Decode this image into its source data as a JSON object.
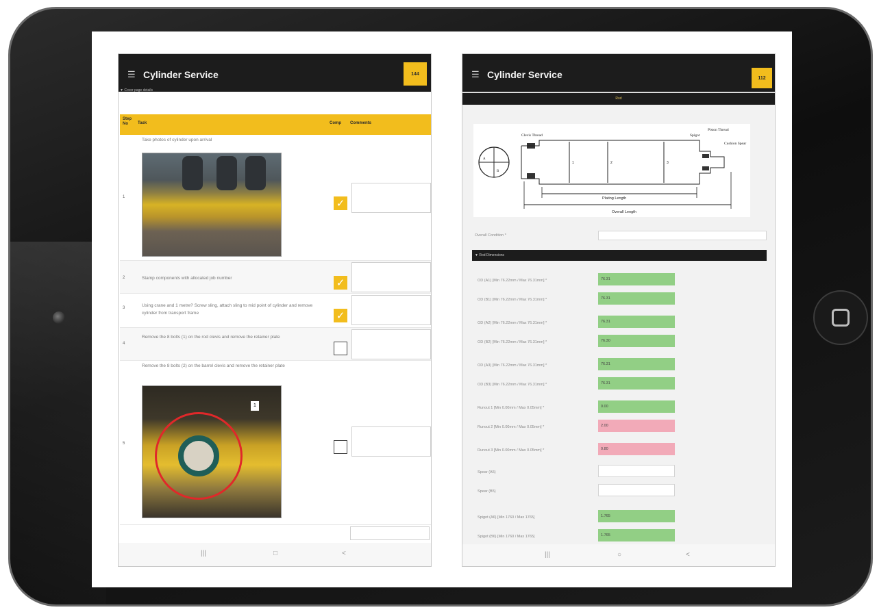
{
  "left_app": {
    "menu_icon": "☰",
    "title": "Cylinder Service",
    "badge": "144",
    "subtitle": "▼ Cover page details",
    "table": {
      "col_step": "Step No",
      "col_task": "Task",
      "col_comp": "Comp",
      "col_comments": "Comments"
    },
    "steps": [
      {
        "num": "1",
        "task": "Take photos of cylinder upon arrival",
        "checked": true
      },
      {
        "num": "2",
        "task": "Stamp components with allocated job number",
        "checked": true
      },
      {
        "num": "3",
        "task": "Using crane and 1 metre? Screw sling, attach sling to mid point of cylinder and remove cylinder from transport frame",
        "checked": true
      },
      {
        "num": "4",
        "task": "Remove the 8 bolts (1) on the rod clevis and remove the retainer plate",
        "checked": false
      },
      {
        "num": "5",
        "task": "Remove the 8 bolts (2) on the barrel clevis and remove the retainer plate",
        "checked": false
      }
    ],
    "photo_tag": "1",
    "checkmark": "✓",
    "nav": {
      "recent": "|||",
      "home": "□",
      "back": "<"
    }
  },
  "right_app": {
    "menu_icon": "☰",
    "title": "Cylinder Service",
    "badge": "112",
    "tab": "Rod",
    "diagram": {
      "clevis_thread": "Clevis Thread",
      "spigot": "Spigot",
      "piston_thread": "Piston Thread",
      "cushion_spear": "Cushion Spear",
      "plating_length": "Plating Length",
      "overall_length": "Overall Length",
      "a": "A",
      "b": "B",
      "m1": "1",
      "m2": "2",
      "m3": "3"
    },
    "overall_condition_label": "Overall Condition *",
    "overall_condition_value": "",
    "section": "▼ Rod Dimensions",
    "fields": [
      {
        "label": "OD (A1) [Min 76.22mm / Max 76.31mm] *",
        "value": "76.31",
        "status": "green"
      },
      {
        "label": "OD (B1) [Min 76.22mm / Max 76.31mm] *",
        "value": "76.31",
        "status": "green"
      },
      {
        "label": "OD (A2) [Min 76.22mm / Max 76.31mm] *",
        "value": "76.31",
        "status": "green"
      },
      {
        "label": "OD (B2) [Min 76.22mm / Max 76.31mm] *",
        "value": "76.30",
        "status": "green"
      },
      {
        "label": "OD (A3) [Min 76.22mm / Max 76.31mm] *",
        "value": "76.31",
        "status": "green"
      },
      {
        "label": "OD (B3) [Min 76.22mm / Max 76.31mm] *",
        "value": "76.31",
        "status": "green"
      },
      {
        "label": "Runout 1 [Min 0.00mm / Max 0.05mm] *",
        "value": "0.00",
        "status": "green"
      },
      {
        "label": "Runout 2 [Min 0.00mm / Max 0.05mm] *",
        "value": "2.00",
        "status": "red"
      },
      {
        "label": "Runout 3 [Min 0.00mm / Max 0.05mm] *",
        "value": "0.80",
        "status": "red"
      },
      {
        "label": "Spear (A5)",
        "value": "",
        "status": "none"
      },
      {
        "label": "Spear (B5)",
        "value": "",
        "status": "none"
      },
      {
        "label": "Spigot (A6) [Min 1760 / Max 1765]",
        "value": "1.765",
        "status": "green"
      },
      {
        "label": "Spigot (B6) [Min 1760 / Max 1765]",
        "value": "1.765",
        "status": "green"
      }
    ],
    "nav": {
      "recent": "|||",
      "home": "○",
      "back": "<"
    }
  },
  "colors": {
    "accent": "#f2bd1d",
    "appbar": "#1c1c1c",
    "ok": "#92cf85",
    "fail": "#f2aab8"
  }
}
